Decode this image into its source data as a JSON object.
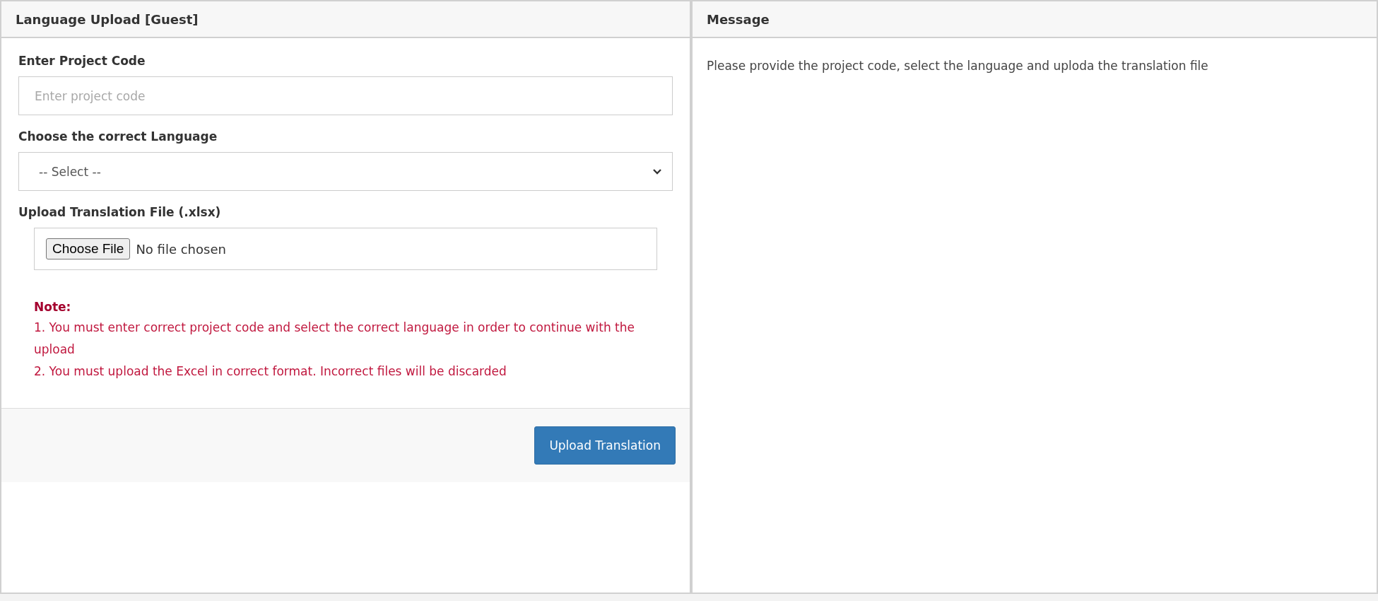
{
  "left_panel": {
    "title": "Language Upload [Guest]",
    "fields": [
      {
        "kind": "text",
        "label": "Enter Project Code",
        "placeholder": "Enter project code"
      },
      {
        "kind": "select",
        "label": "Choose the correct Language",
        "value": "-- Select --"
      },
      {
        "kind": "file",
        "label": "Upload Translation File (.xlsx)",
        "button": "Choose File",
        "value": "No file chosen"
      }
    ],
    "note": {
      "title": "Note:",
      "items": [
        "1. You must enter correct project code and select the correct language in order to continue with the upload",
        "2. You must upload the Excel in correct format. Incorrect files will be discarded"
      ]
    },
    "submit_button": "Upload Translation"
  },
  "right_panel": {
    "title": "Message",
    "text": "Please provide the project code, select the language and uploda the translation file"
  }
}
